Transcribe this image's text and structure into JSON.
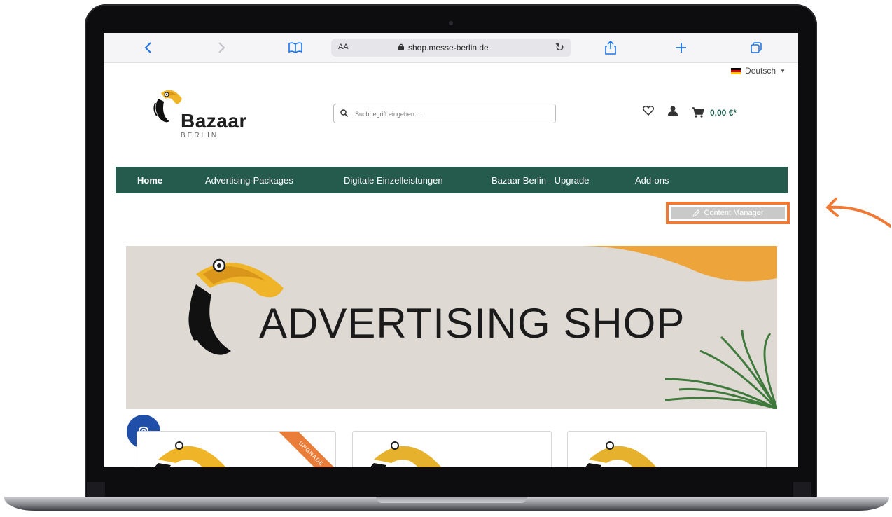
{
  "browser": {
    "text_size_label": "AA",
    "url": "shop.messe-berlin.de"
  },
  "header": {
    "language": "Deutsch",
    "logo_word": "Bazaar",
    "logo_sub": "BERLIN",
    "search_placeholder": "Suchbegriff eingeben ...",
    "cart_total": "0,00 €*"
  },
  "nav": {
    "items": [
      {
        "label": "Home"
      },
      {
        "label": "Advertising-Packages"
      },
      {
        "label": "Digitale Einzelleistungen"
      },
      {
        "label": "Bazaar Berlin - Upgrade"
      },
      {
        "label": "Add-ons"
      }
    ]
  },
  "content_manager": {
    "label": "Content Manager"
  },
  "banner": {
    "title": "ADVERTISING SHOP"
  },
  "cards": [
    {
      "ribbon": "UPGRADE"
    },
    {
      "ribbon": ""
    },
    {
      "ribbon": ""
    }
  ],
  "colors": {
    "nav_bg": "#245b4d",
    "accent_orange": "#ee7a35",
    "banner_bg": "#dedad3",
    "safari_blue": "#1a73e8"
  }
}
